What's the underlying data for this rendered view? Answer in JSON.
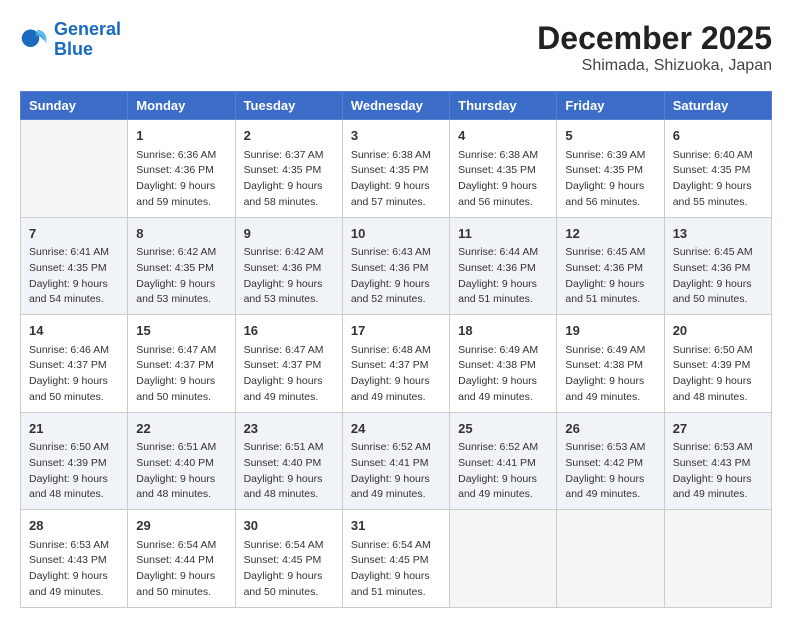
{
  "logo": {
    "name_part1": "General",
    "name_part2": "Blue"
  },
  "title": "December 2025",
  "subtitle": "Shimada, Shizuoka, Japan",
  "days_of_week": [
    "Sunday",
    "Monday",
    "Tuesday",
    "Wednesday",
    "Thursday",
    "Friday",
    "Saturday"
  ],
  "weeks": [
    [
      {
        "day": "",
        "info": ""
      },
      {
        "day": "1",
        "info": "Sunrise: 6:36 AM\nSunset: 4:36 PM\nDaylight: 9 hours\nand 59 minutes."
      },
      {
        "day": "2",
        "info": "Sunrise: 6:37 AM\nSunset: 4:35 PM\nDaylight: 9 hours\nand 58 minutes."
      },
      {
        "day": "3",
        "info": "Sunrise: 6:38 AM\nSunset: 4:35 PM\nDaylight: 9 hours\nand 57 minutes."
      },
      {
        "day": "4",
        "info": "Sunrise: 6:38 AM\nSunset: 4:35 PM\nDaylight: 9 hours\nand 56 minutes."
      },
      {
        "day": "5",
        "info": "Sunrise: 6:39 AM\nSunset: 4:35 PM\nDaylight: 9 hours\nand 56 minutes."
      },
      {
        "day": "6",
        "info": "Sunrise: 6:40 AM\nSunset: 4:35 PM\nDaylight: 9 hours\nand 55 minutes."
      }
    ],
    [
      {
        "day": "7",
        "info": "Sunrise: 6:41 AM\nSunset: 4:35 PM\nDaylight: 9 hours\nand 54 minutes."
      },
      {
        "day": "8",
        "info": "Sunrise: 6:42 AM\nSunset: 4:35 PM\nDaylight: 9 hours\nand 53 minutes."
      },
      {
        "day": "9",
        "info": "Sunrise: 6:42 AM\nSunset: 4:36 PM\nDaylight: 9 hours\nand 53 minutes."
      },
      {
        "day": "10",
        "info": "Sunrise: 6:43 AM\nSunset: 4:36 PM\nDaylight: 9 hours\nand 52 minutes."
      },
      {
        "day": "11",
        "info": "Sunrise: 6:44 AM\nSunset: 4:36 PM\nDaylight: 9 hours\nand 51 minutes."
      },
      {
        "day": "12",
        "info": "Sunrise: 6:45 AM\nSunset: 4:36 PM\nDaylight: 9 hours\nand 51 minutes."
      },
      {
        "day": "13",
        "info": "Sunrise: 6:45 AM\nSunset: 4:36 PM\nDaylight: 9 hours\nand 50 minutes."
      }
    ],
    [
      {
        "day": "14",
        "info": "Sunrise: 6:46 AM\nSunset: 4:37 PM\nDaylight: 9 hours\nand 50 minutes."
      },
      {
        "day": "15",
        "info": "Sunrise: 6:47 AM\nSunset: 4:37 PM\nDaylight: 9 hours\nand 50 minutes."
      },
      {
        "day": "16",
        "info": "Sunrise: 6:47 AM\nSunset: 4:37 PM\nDaylight: 9 hours\nand 49 minutes."
      },
      {
        "day": "17",
        "info": "Sunrise: 6:48 AM\nSunset: 4:37 PM\nDaylight: 9 hours\nand 49 minutes."
      },
      {
        "day": "18",
        "info": "Sunrise: 6:49 AM\nSunset: 4:38 PM\nDaylight: 9 hours\nand 49 minutes."
      },
      {
        "day": "19",
        "info": "Sunrise: 6:49 AM\nSunset: 4:38 PM\nDaylight: 9 hours\nand 49 minutes."
      },
      {
        "day": "20",
        "info": "Sunrise: 6:50 AM\nSunset: 4:39 PM\nDaylight: 9 hours\nand 48 minutes."
      }
    ],
    [
      {
        "day": "21",
        "info": "Sunrise: 6:50 AM\nSunset: 4:39 PM\nDaylight: 9 hours\nand 48 minutes."
      },
      {
        "day": "22",
        "info": "Sunrise: 6:51 AM\nSunset: 4:40 PM\nDaylight: 9 hours\nand 48 minutes."
      },
      {
        "day": "23",
        "info": "Sunrise: 6:51 AM\nSunset: 4:40 PM\nDaylight: 9 hours\nand 48 minutes."
      },
      {
        "day": "24",
        "info": "Sunrise: 6:52 AM\nSunset: 4:41 PM\nDaylight: 9 hours\nand 49 minutes."
      },
      {
        "day": "25",
        "info": "Sunrise: 6:52 AM\nSunset: 4:41 PM\nDaylight: 9 hours\nand 49 minutes."
      },
      {
        "day": "26",
        "info": "Sunrise: 6:53 AM\nSunset: 4:42 PM\nDaylight: 9 hours\nand 49 minutes."
      },
      {
        "day": "27",
        "info": "Sunrise: 6:53 AM\nSunset: 4:43 PM\nDaylight: 9 hours\nand 49 minutes."
      }
    ],
    [
      {
        "day": "28",
        "info": "Sunrise: 6:53 AM\nSunset: 4:43 PM\nDaylight: 9 hours\nand 49 minutes."
      },
      {
        "day": "29",
        "info": "Sunrise: 6:54 AM\nSunset: 4:44 PM\nDaylight: 9 hours\nand 50 minutes."
      },
      {
        "day": "30",
        "info": "Sunrise: 6:54 AM\nSunset: 4:45 PM\nDaylight: 9 hours\nand 50 minutes."
      },
      {
        "day": "31",
        "info": "Sunrise: 6:54 AM\nSunset: 4:45 PM\nDaylight: 9 hours\nand 51 minutes."
      },
      {
        "day": "",
        "info": ""
      },
      {
        "day": "",
        "info": ""
      },
      {
        "day": "",
        "info": ""
      }
    ]
  ]
}
